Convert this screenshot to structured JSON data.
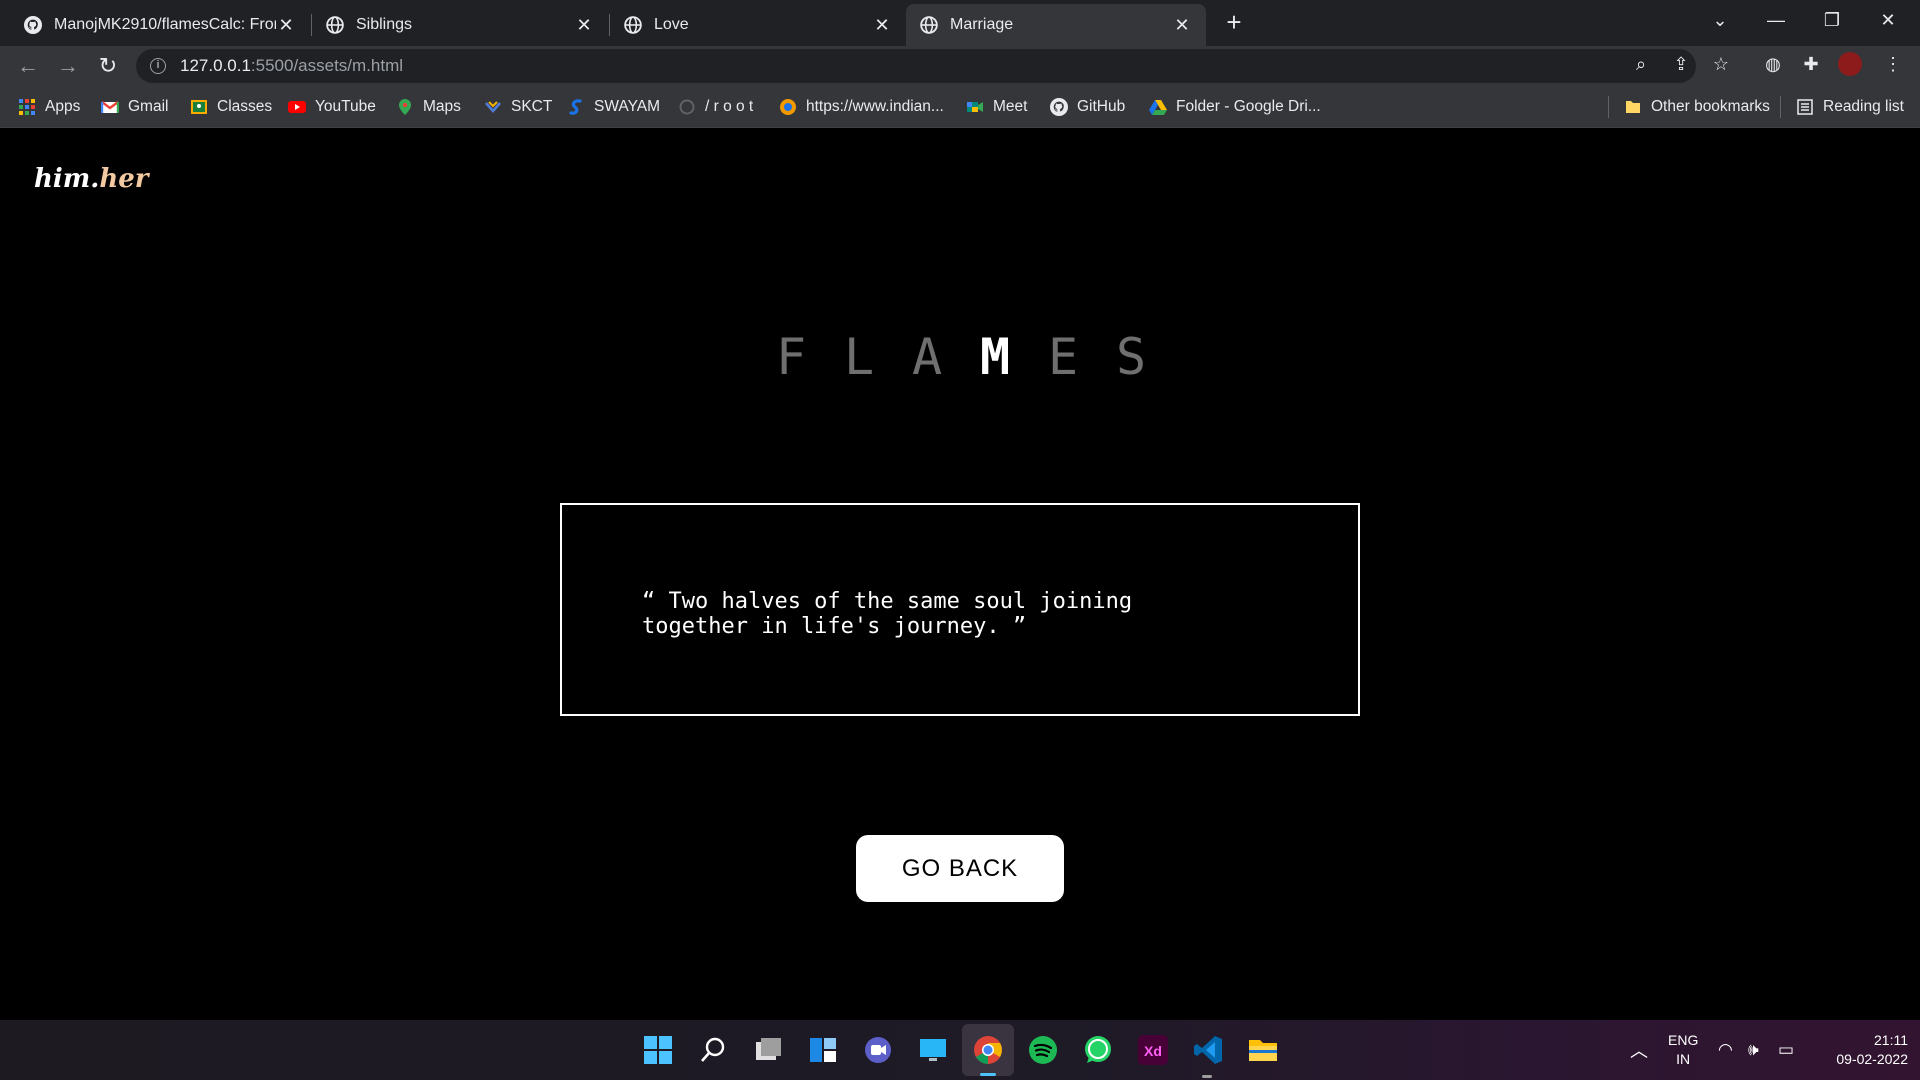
{
  "browser": {
    "tabs": [
      {
        "title": "ManojMK2910/flamesCalc: Front",
        "icon": "github-icon",
        "active": false
      },
      {
        "title": "Siblings",
        "icon": "globe-icon",
        "active": false
      },
      {
        "title": "Love",
        "icon": "globe-icon",
        "active": false
      },
      {
        "title": "Marriage",
        "icon": "globe-icon",
        "active": true
      }
    ],
    "url_host": "127.0.0.1",
    "url_path": ":5500/assets/m.html",
    "bookmarks": [
      {
        "label": "Apps",
        "icon": "apps-grid-icon",
        "color": "#4285f4"
      },
      {
        "label": "Gmail",
        "icon": "gmail-icon",
        "color": "#ea4335"
      },
      {
        "label": "Classes",
        "icon": "classroom-icon",
        "color": "#f9ab00"
      },
      {
        "label": "YouTube",
        "icon": "youtube-icon",
        "color": "#ff0000"
      },
      {
        "label": "Maps",
        "icon": "maps-icon",
        "color": "#34a853"
      },
      {
        "label": "SKCT",
        "icon": "skct-icon",
        "color": "#4f7cd6"
      },
      {
        "label": "SWAYAM",
        "icon": "swayam-icon",
        "color": "#1a73e8"
      },
      {
        "label": "/ r o o t",
        "icon": "root-icon",
        "color": "#5f6368"
      },
      {
        "label": "https://www.indian...",
        "icon": "indian-icon",
        "color": "#f29900"
      },
      {
        "label": "Meet",
        "icon": "meet-icon",
        "color": "#00897b"
      },
      {
        "label": "GitHub",
        "icon": "github-icon",
        "color": "#e8eaed"
      },
      {
        "label": "Folder - Google Dri...",
        "icon": "drive-icon",
        "color": "#fbbc04"
      }
    ],
    "other_bookmarks": "Other bookmarks",
    "reading_list": "Reading list"
  },
  "page": {
    "logo_main": "him.",
    "logo_accent": "her",
    "flames_letters": [
      "F",
      "L",
      "A",
      "M",
      "E",
      "S"
    ],
    "highlighted_letter": "M",
    "quote": "“ Two halves of the same soul joining\ntogether in life's journey. ”",
    "go_back_label": "GO BACK"
  },
  "taskbar": {
    "apps": [
      "windows-start-icon",
      "search-icon",
      "task-view-icon",
      "widgets-icon",
      "teams-chat-icon",
      "remote-desktop-icon",
      "chrome-icon",
      "spotify-icon",
      "whatsapp-icon",
      "adobe-xd-icon",
      "vscode-icon",
      "file-explorer-icon"
    ],
    "lang_top": "ENG",
    "lang_bottom": "IN",
    "time": "21:11",
    "date": "09-02-2022"
  },
  "colors": {
    "page_bg": "#000000",
    "flames_dim": "#6f6f6f",
    "flames_highlight": "#ffffff",
    "logo_accent": "#f2c9a0",
    "chrome_dark": "#202124",
    "chrome_mid": "#35363a"
  }
}
